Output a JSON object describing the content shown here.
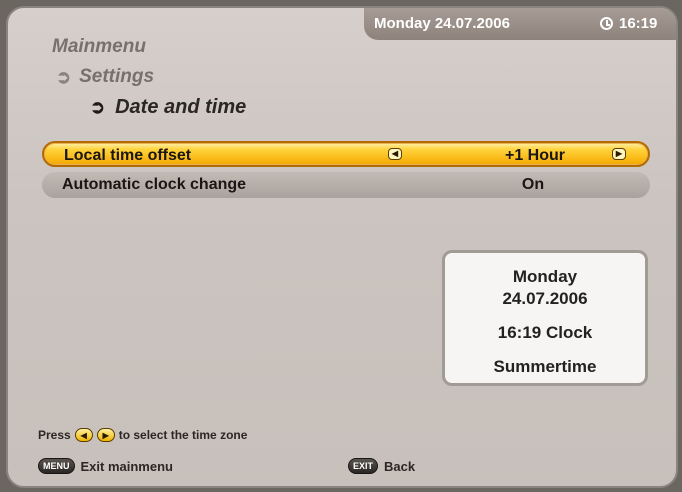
{
  "status_bar": {
    "date": "Monday 24.07.2006",
    "time": "16:19"
  },
  "breadcrumb": {
    "level1": "Mainmenu",
    "level2": "Settings",
    "level3": "Date and time"
  },
  "settings": [
    {
      "label": "Local time offset",
      "value": "+1 Hour",
      "selected": true
    },
    {
      "label": "Automatic clock change",
      "value": "On",
      "selected": false
    }
  ],
  "info_box": {
    "day": "Monday",
    "date": "24.07.2006",
    "time": "16:19 Clock",
    "season": "Summertime"
  },
  "hint": {
    "prefix": "Press",
    "suffix": "to select the time zone"
  },
  "footer": {
    "menu_key": "MENU",
    "menu_label": "Exit mainmenu",
    "exit_key": "EXIT",
    "exit_label": "Back"
  },
  "colors": {
    "accent": "#f5a800",
    "background": "#cbc4c0"
  }
}
